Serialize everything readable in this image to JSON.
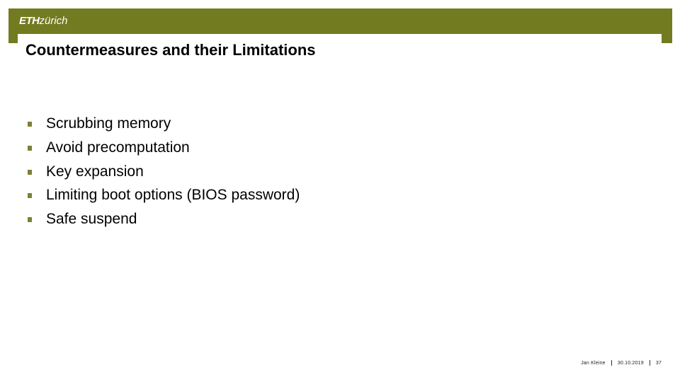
{
  "header": {
    "logo_bold": "ETH",
    "logo_light": "zürich",
    "brand_color": "#737b20"
  },
  "slide": {
    "title": "Countermeasures and their Limitations",
    "bullet_icon": "square-bullet-icon",
    "bullet_color": "#7d8032",
    "bullets": [
      "Scrubbing memory",
      "Avoid precomputation",
      "Key expansion",
      "Limiting boot options (BIOS password)",
      "Safe suspend"
    ]
  },
  "footer": {
    "author": "Jan Kleine",
    "date": "30.10.2019",
    "page_number": "37"
  }
}
